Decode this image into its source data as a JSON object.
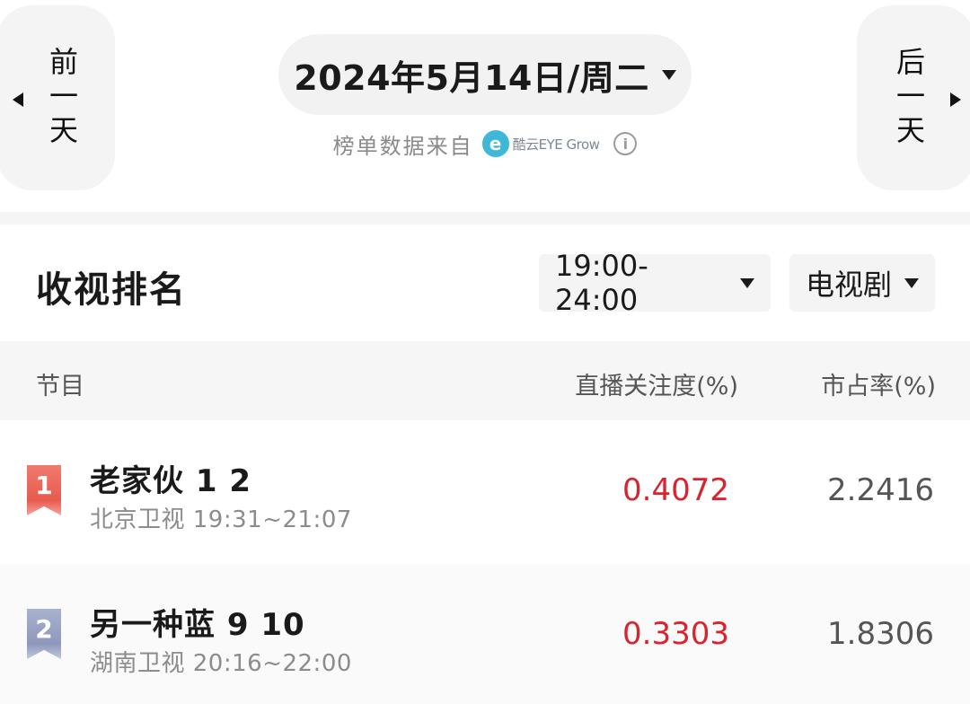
{
  "nav": {
    "prev_label": "前一天",
    "next_label": "后一天"
  },
  "date_selector": {
    "label": "2024年5月14日/周二"
  },
  "source": {
    "label": "榜单数据来自",
    "brand_name": "酷云EYE Grow",
    "brand_logo_letter": "e",
    "info_glyph": "i"
  },
  "section": {
    "title": "收视排名"
  },
  "filters": {
    "time_range": "19:00-24:00",
    "category": "电视剧"
  },
  "table": {
    "columns": [
      "节目",
      "直播关注度(%)",
      "市占率(%)"
    ],
    "rows": [
      {
        "rank": "1",
        "name": "老家伙 1 2",
        "meta": "北京卫视 19:31~21:07",
        "rating": "0.4072",
        "share": "2.2416"
      },
      {
        "rank": "2",
        "name": "另一种蓝 9 10",
        "meta": "湖南卫视 20:16~22:00",
        "rating": "0.3303",
        "share": "1.8306"
      }
    ]
  },
  "colors": {
    "rating_red": "#d9232e",
    "rank_1": "#e85b4f",
    "rank_2": "#8e98bb",
    "brand_blue": "#3fb7d6"
  }
}
